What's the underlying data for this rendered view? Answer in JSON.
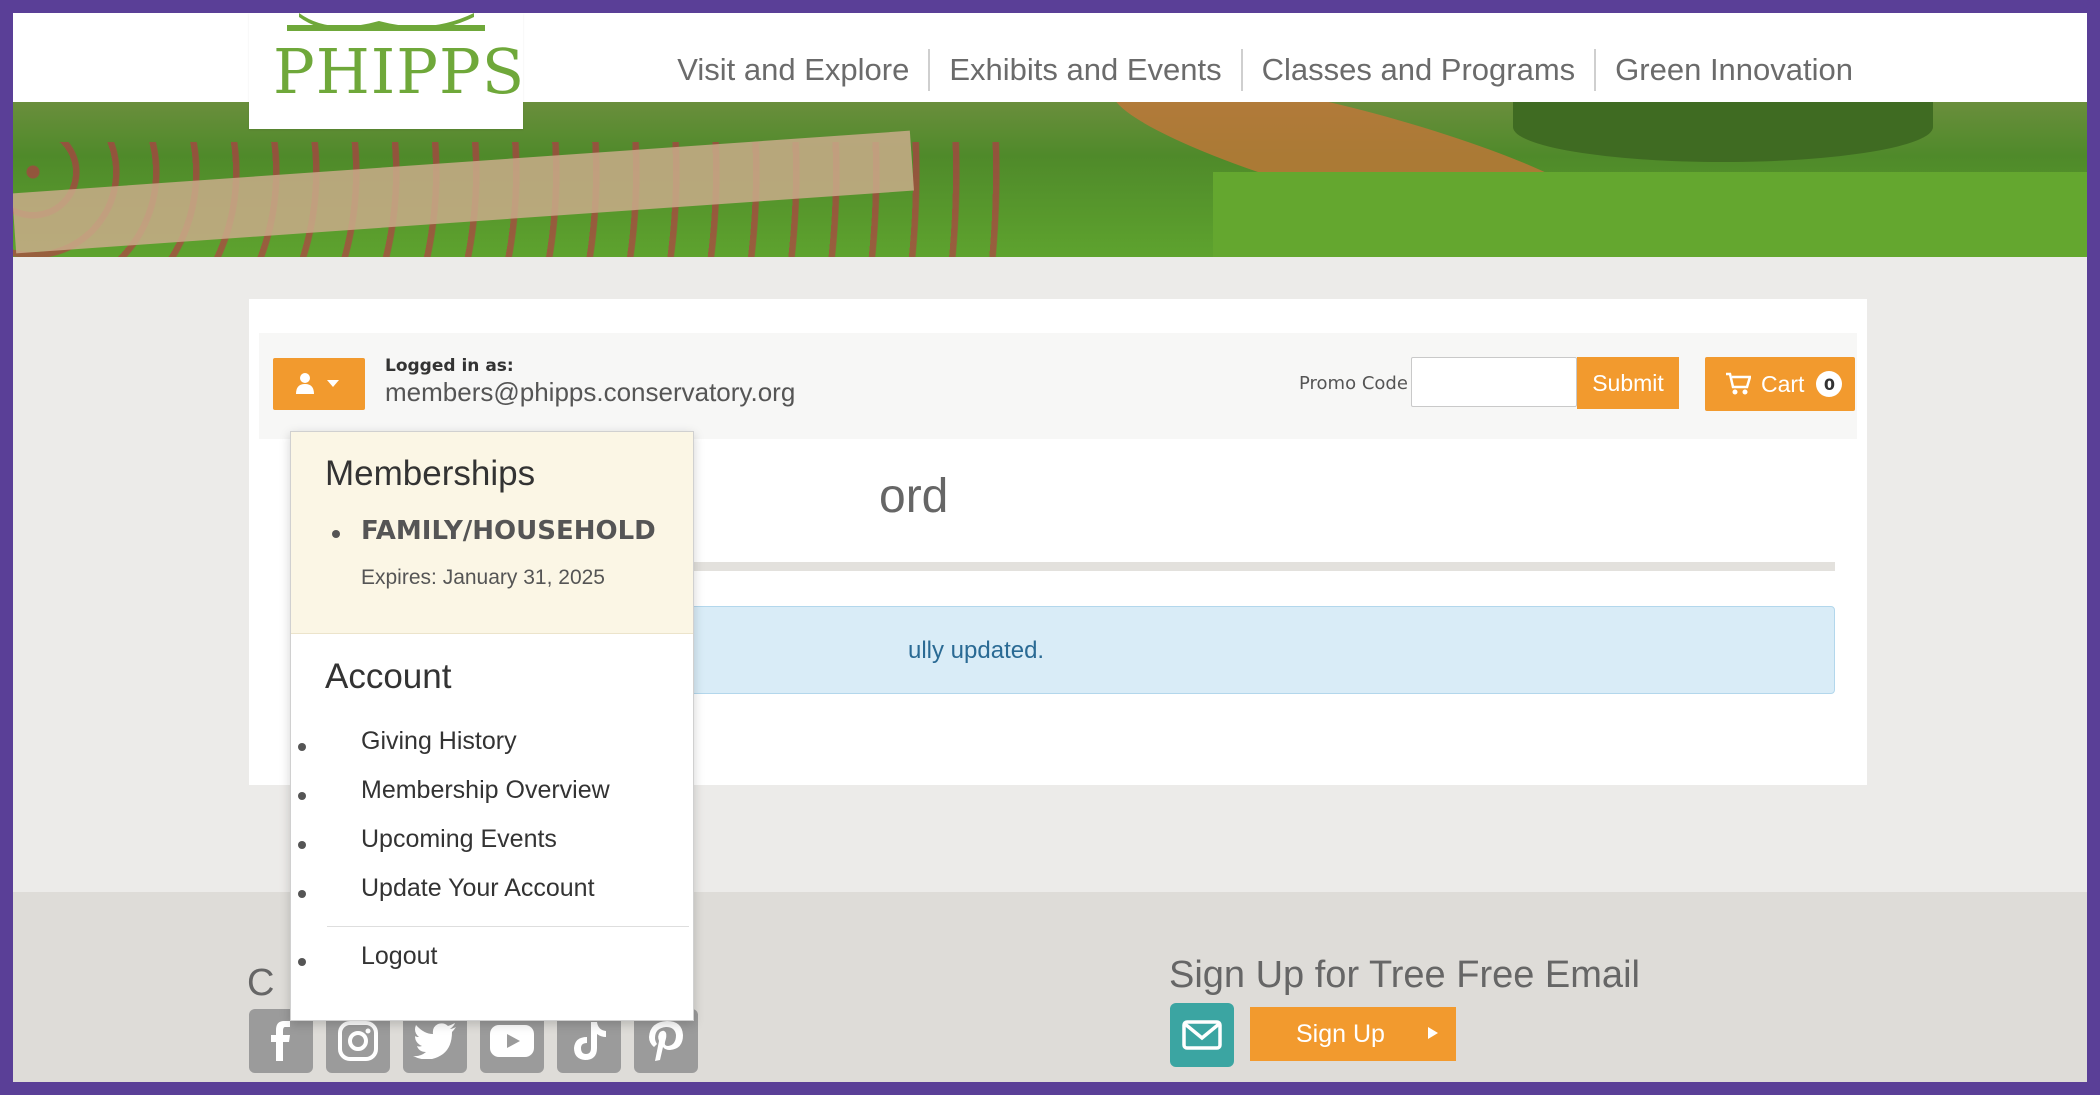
{
  "header": {
    "logo_text": "PHIPPS",
    "nav": [
      "Visit and Explore",
      "Exhibits and Events",
      "Classes and Programs",
      "Green Innovation"
    ]
  },
  "toolbar": {
    "logged_in_label": "Logged in as:",
    "email": "members@phipps.conservatory.org",
    "promo_label": "Promo Code",
    "promo_value": "",
    "submit_label": "Submit",
    "cart_label": "Cart",
    "cart_count": "0",
    "user_icon": "user-icon",
    "cart_icon": "cart-icon"
  },
  "main": {
    "heading_visible": "ord",
    "alert_visible": "ully updated."
  },
  "dropdown": {
    "memberships_heading": "Memberships",
    "membership_type": "FAMILY/HOUSEHOLD",
    "expires": "Expires: January 31, 2025",
    "account_heading": "Account",
    "links": [
      "Giving History",
      "Membership Overview",
      "Upcoming Events",
      "Update Your Account"
    ],
    "logout": "Logout"
  },
  "footer": {
    "left_heading_visible": "C",
    "social": [
      "facebook-icon",
      "instagram-icon",
      "twitter-icon",
      "youtube-icon",
      "tiktok-icon",
      "pinterest-icon"
    ],
    "signup_title": "Sign Up for Tree Free Email",
    "signup_label": "Sign Up"
  },
  "colors": {
    "accent": "#f29a2e",
    "brand_green": "#6fa83a",
    "frame": "#5a3f97",
    "teal": "#3ba5a2"
  }
}
